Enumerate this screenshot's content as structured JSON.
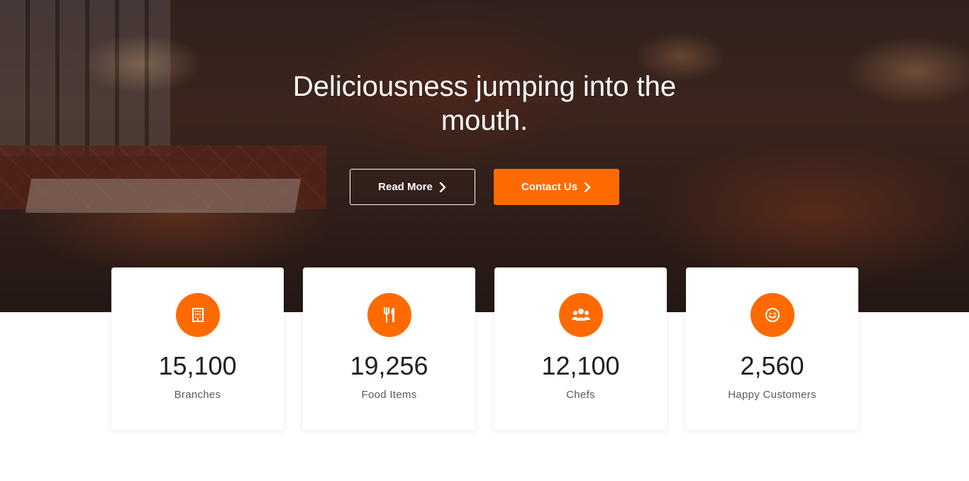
{
  "hero": {
    "headline": "Deliciousness jumping into the mouth.",
    "read_more_label": "Read More",
    "contact_label": "Contact Us"
  },
  "colors": {
    "accent": "#ff6a00",
    "text_dark": "#1f1f1f",
    "text_muted": "#5a5a5a"
  },
  "stats": [
    {
      "icon": "building-icon",
      "value": "15,100",
      "label": "Branches"
    },
    {
      "icon": "cutlery-icon",
      "value": "19,256",
      "label": "Food Items"
    },
    {
      "icon": "users-icon",
      "value": "12,100",
      "label": "Chefs"
    },
    {
      "icon": "smile-icon",
      "value": "2,560",
      "label": "Happy Customers"
    }
  ]
}
